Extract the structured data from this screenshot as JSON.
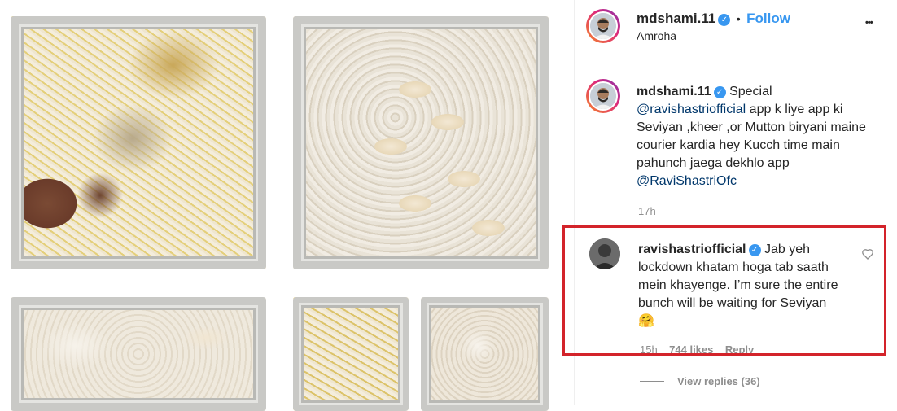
{
  "post": {
    "username": "mdshami.11",
    "location": "Amroha",
    "follow_label": "Follow",
    "separator": "•",
    "more_label": "•••"
  },
  "caption": {
    "username": "mdshami.11",
    "text_1": "Special",
    "mention_1": "@ravishastriofficial",
    "text_2": " app k liye app ki Seviyan ,kheer ,or Mutton biryani maine courier kardia hey Kucch time main pahunch jaega dekhlo app",
    "mention_2": "@RaviShastriOfc",
    "time": "17h"
  },
  "comment": {
    "username": "ravishastriofficial",
    "text": "Jab yeh lockdown khatam hoga tab saath mein khayenge. I’m sure the entire bunch will be waiting for Seviyan",
    "emoji": "🤗",
    "time": "15h",
    "likes": "744 likes",
    "reply_label": "Reply",
    "view_replies": "View replies (36)"
  },
  "colors": {
    "accent": "#3897f0",
    "highlight": "#d3232a",
    "text": "#262626",
    "muted": "#8e8e8e"
  },
  "icons": {
    "verified": "verified-badge-icon",
    "like": "heart-icon",
    "more": "more-options-icon"
  }
}
